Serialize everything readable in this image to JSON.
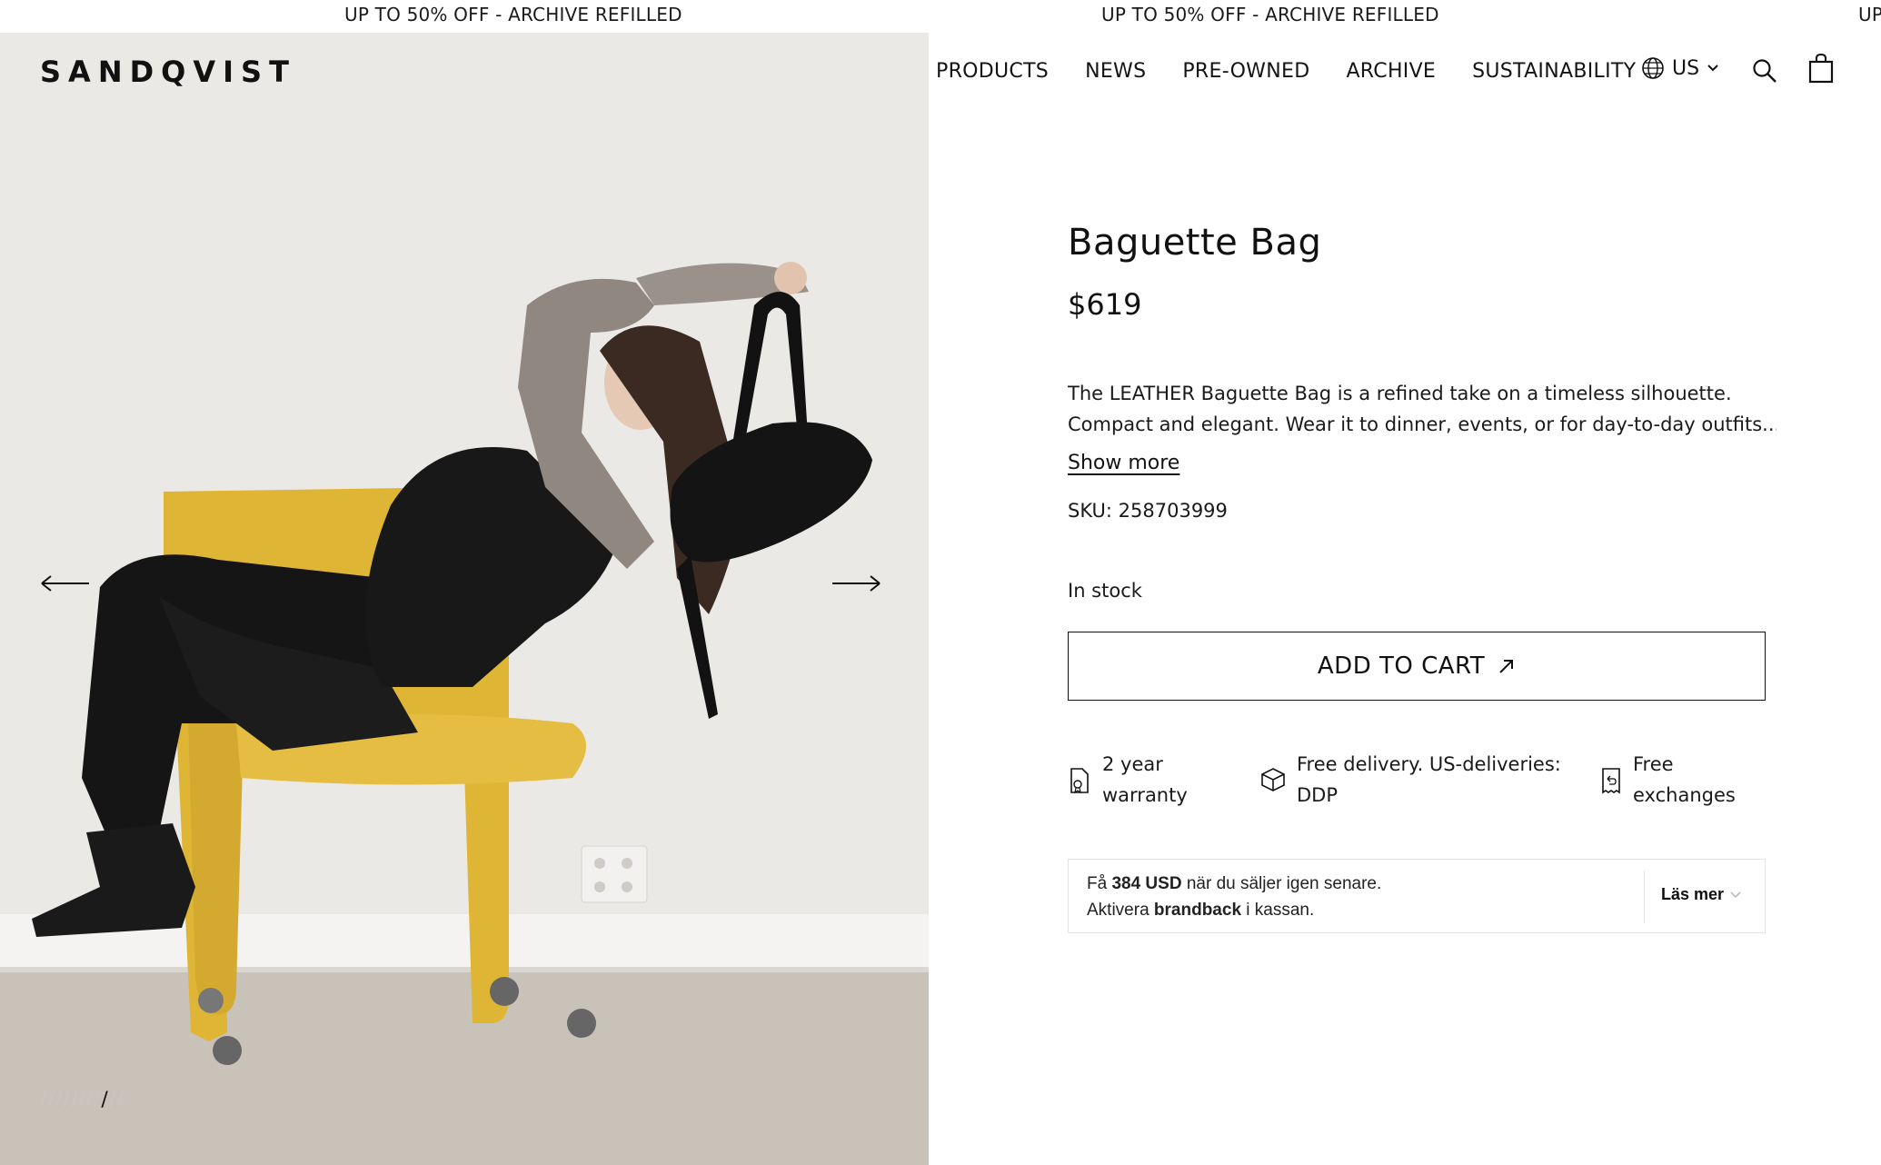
{
  "announcement": {
    "items": [
      "UP TO 50% OFF - ARCHIVE REFILLED",
      "UP TO 50% OFF - ARCHIVE REFILLED",
      "UP"
    ]
  },
  "header": {
    "logo": "SANDQVIST",
    "nav": [
      "PRODUCTS",
      "NEWS",
      "PRE-OWNED",
      "ARCHIVE",
      "SUSTAINABILITY"
    ],
    "locale": "US"
  },
  "gallery": {
    "prev_icon": "arrow-left-icon",
    "next_icon": "arrow-right-icon",
    "slide_count": 10,
    "active_slide": 8
  },
  "product": {
    "title": "Baguette Bag",
    "price": "$619",
    "description_line1": "The LEATHER Baguette Bag is a refined take on a timeless silhouette.",
    "description_line2": "Compact and elegant. Wear it to dinner, events, or for day-to-day outfits....",
    "show_more": "Show more",
    "sku": "SKU: 258703999",
    "stock": "In stock",
    "add_to_cart": "ADD TO CART"
  },
  "perks": [
    {
      "icon": "warranty-icon",
      "line1": "2 year",
      "line2": "warranty"
    },
    {
      "icon": "box-icon",
      "line1": "Free delivery. US-deliveries:",
      "line2": "DDP"
    },
    {
      "icon": "exchange-icon",
      "line1": "Free",
      "line2": "exchanges"
    }
  ],
  "brandback": {
    "text_prefix": "Få ",
    "amount": "384 USD",
    "text_suffix": " när du säljer igen senare.",
    "line2_prefix": "Aktivera ",
    "brand": "brandback",
    "line2_suffix": " i kassan.",
    "more": "Läs mer"
  },
  "colors": {
    "chair": "#e0b83a",
    "background": "#ebe9e6",
    "floor": "#c9c2b8"
  }
}
